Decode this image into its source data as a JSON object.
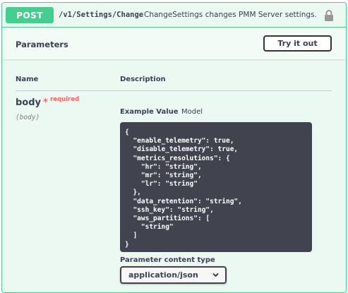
{
  "operation": {
    "method": "POST",
    "path": "/v1/Settings/Change",
    "summary": "ChangeSettings changes PMM Server settings.",
    "lock_icon": "lock-icon",
    "color": "#49cc90"
  },
  "parameters": {
    "title": "Parameters",
    "try_it_out_label": "Try it out",
    "columns": {
      "name": "Name",
      "description": "Description"
    },
    "items": [
      {
        "name": "body",
        "required_marker": "*",
        "required_label": "required",
        "in": "(body)",
        "tabs": {
          "example": "Example Value",
          "model": "Model"
        },
        "example": "{\n  \"enable_telemetry\": true,\n  \"disable_telemetry\": true,\n  \"metrics_resolutions\": {\n    \"hr\": \"string\",\n    \"mr\": \"string\",\n    \"lr\": \"string\"\n  },\n  \"data_retention\": \"string\",\n  \"ssh_key\": \"string\",\n  \"aws_partitions\": [\n    \"string\"\n  ]\n}",
        "content_type_label": "Parameter content type",
        "content_type_value": "application/json",
        "content_type_icon": "chevron-down-icon"
      }
    ]
  }
}
